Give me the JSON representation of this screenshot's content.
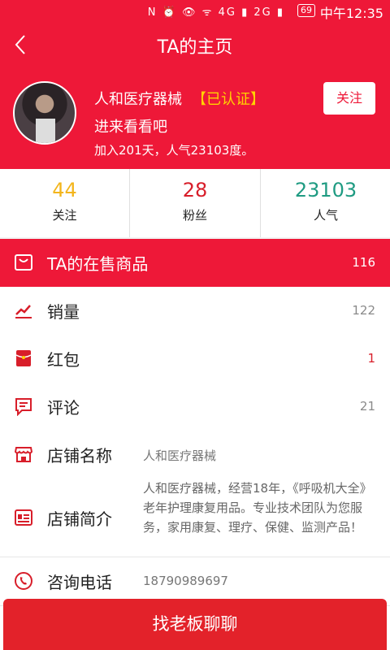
{
  "status_bar": {
    "icons": "N ⏰ 👁 ᯤ 4G ▮ 2G ▮",
    "battery": "69",
    "time": "中午12:35"
  },
  "header": {
    "title": "TA的主页"
  },
  "profile": {
    "shop_name": "人和医疗器械",
    "verified": "【已认证】",
    "intro": "进来看看吧",
    "joined": "加入201天，人气23103度。",
    "follow_button": "关注"
  },
  "stats": [
    {
      "value": "44",
      "label": "关注",
      "color": "#f3b51c"
    },
    {
      "value": "28",
      "label": "粉丝",
      "color": "#d81e2a"
    },
    {
      "value": "23103",
      "label": "人气",
      "color": "#1f9b82"
    }
  ],
  "rows": {
    "on_sale": {
      "label": "TA的在售商品",
      "count": "116"
    },
    "sales": {
      "label": "销量",
      "count": "122"
    },
    "red_packet": {
      "label": "红包",
      "count": "1",
      "count_color": "#d81e2a"
    },
    "comments": {
      "label": "评论",
      "count": "21"
    },
    "store_name": {
      "label": "店铺名称",
      "value": "人和医疗器械"
    },
    "store_intro": {
      "label": "店铺简介",
      "value": "人和医疗器械，经营18年，《呼吸机大全》老年护理康复用品。专业技术团队为您服务，家用康复、理疗、保健、监测产品！"
    },
    "phone": {
      "label": "咨询电话",
      "value": "18790989697"
    }
  },
  "bottom_button": "找老板聊聊",
  "colors": {
    "brand_red": "#ee1838",
    "icon_red": "#d81e2a"
  }
}
